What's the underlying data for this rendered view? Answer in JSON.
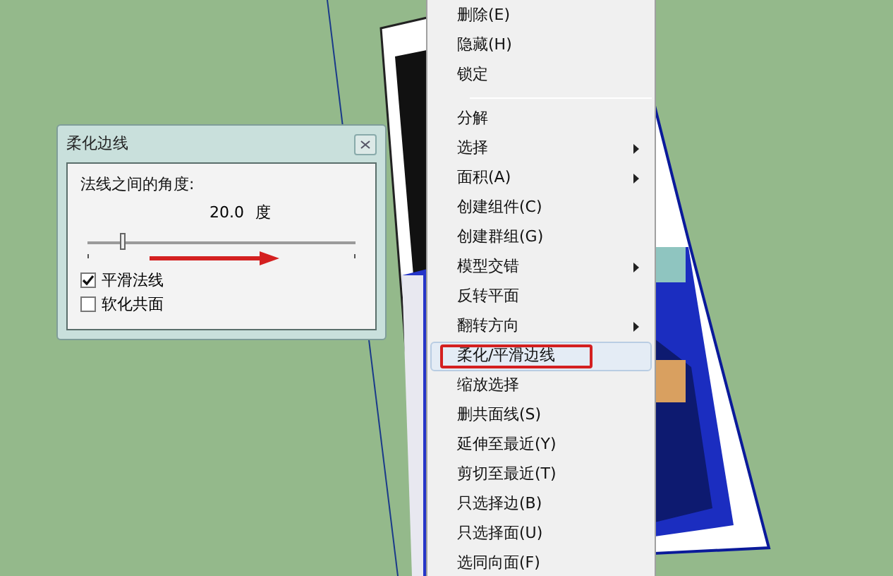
{
  "dialog": {
    "title": "柔化边线",
    "angle_label": "法线之间的角度:",
    "angle_value": "20.0",
    "angle_unit": "度",
    "slider": {
      "level": 0.13
    },
    "checkboxes": [
      {
        "label": "平滑法线",
        "checked": true
      },
      {
        "label": "软化共面",
        "checked": false
      }
    ]
  },
  "context_menu": {
    "items": [
      {
        "kind": "item",
        "label": "删除(E)",
        "submenu": false,
        "selected": false
      },
      {
        "kind": "item",
        "label": "隐藏(H)",
        "submenu": false,
        "selected": false
      },
      {
        "kind": "item",
        "label": "锁定",
        "submenu": false,
        "selected": false
      },
      {
        "kind": "separator"
      },
      {
        "kind": "item",
        "label": "分解",
        "submenu": false,
        "selected": false
      },
      {
        "kind": "item",
        "label": "选择",
        "submenu": true,
        "selected": false
      },
      {
        "kind": "item",
        "label": "面积(A)",
        "submenu": true,
        "selected": false
      },
      {
        "kind": "item",
        "label": "创建组件(C)",
        "submenu": false,
        "selected": false
      },
      {
        "kind": "item",
        "label": "创建群组(G)",
        "submenu": false,
        "selected": false
      },
      {
        "kind": "item",
        "label": "模型交错",
        "submenu": true,
        "selected": false
      },
      {
        "kind": "item",
        "label": "反转平面",
        "submenu": false,
        "selected": false
      },
      {
        "kind": "item",
        "label": "翻转方向",
        "submenu": true,
        "selected": false
      },
      {
        "kind": "item",
        "label": "柔化/平滑边线",
        "submenu": false,
        "selected": true
      },
      {
        "kind": "item",
        "label": "缩放选择",
        "submenu": false,
        "selected": false
      },
      {
        "kind": "item",
        "label": "删共面线(S)",
        "submenu": false,
        "selected": false
      },
      {
        "kind": "item",
        "label": "延伸至最近(Y)",
        "submenu": false,
        "selected": false
      },
      {
        "kind": "item",
        "label": "剪切至最近(T)",
        "submenu": false,
        "selected": false
      },
      {
        "kind": "item",
        "label": "只选择边(B)",
        "submenu": false,
        "selected": false
      },
      {
        "kind": "item",
        "label": "只选择面(U)",
        "submenu": false,
        "selected": false
      },
      {
        "kind": "item",
        "label": "选同向面(F)",
        "submenu": false,
        "selected": false
      }
    ]
  }
}
